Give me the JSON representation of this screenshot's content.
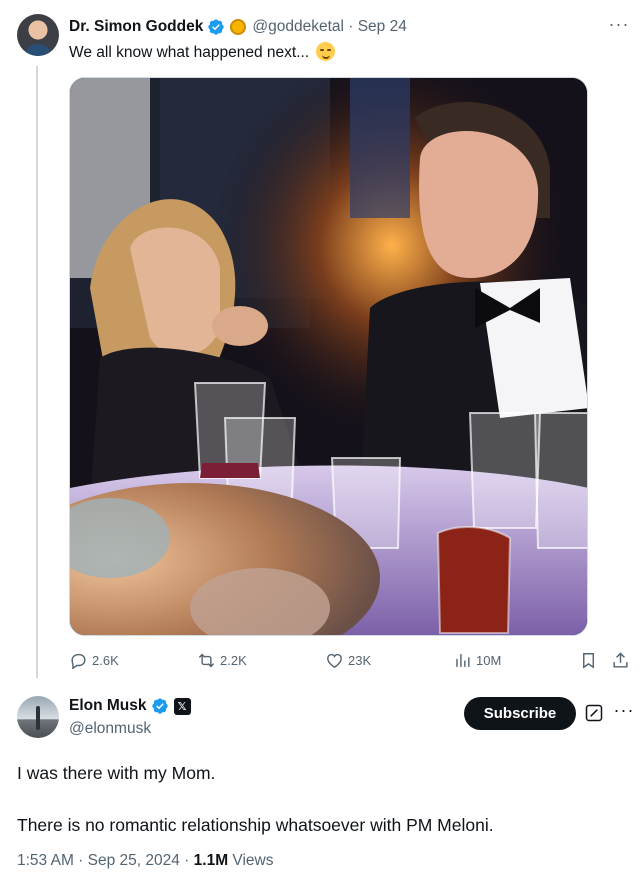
{
  "reply_tweet": {
    "author_name": "Dr. Simon Goddek",
    "handle_and_time": "@goddeketal · Sep 24",
    "text": "We all know what happened next...",
    "text_emoji": "smirking-face-emoji",
    "more_label": "···",
    "stats": {
      "replies": "2.6K",
      "reposts": "2.2K",
      "likes": "23K",
      "views": "10M"
    }
  },
  "main_tweet": {
    "author_name": "Elon Musk",
    "handle": "@elonmusk",
    "subscribe_label": "Subscribe",
    "more_label": "···",
    "text_line1": "I was there with my Mom.",
    "text_line2": "There is no romantic relationship whatsoever with PM Meloni.",
    "time": "1:53 AM · Sep 25, 2024 · ",
    "views_count": "1.1M",
    "views_label": " Views"
  },
  "colors": {
    "verified_blue": "#1d9bf0",
    "text_primary": "#0f1419",
    "text_secondary": "#536471",
    "thread_line": "#cfd9de"
  }
}
